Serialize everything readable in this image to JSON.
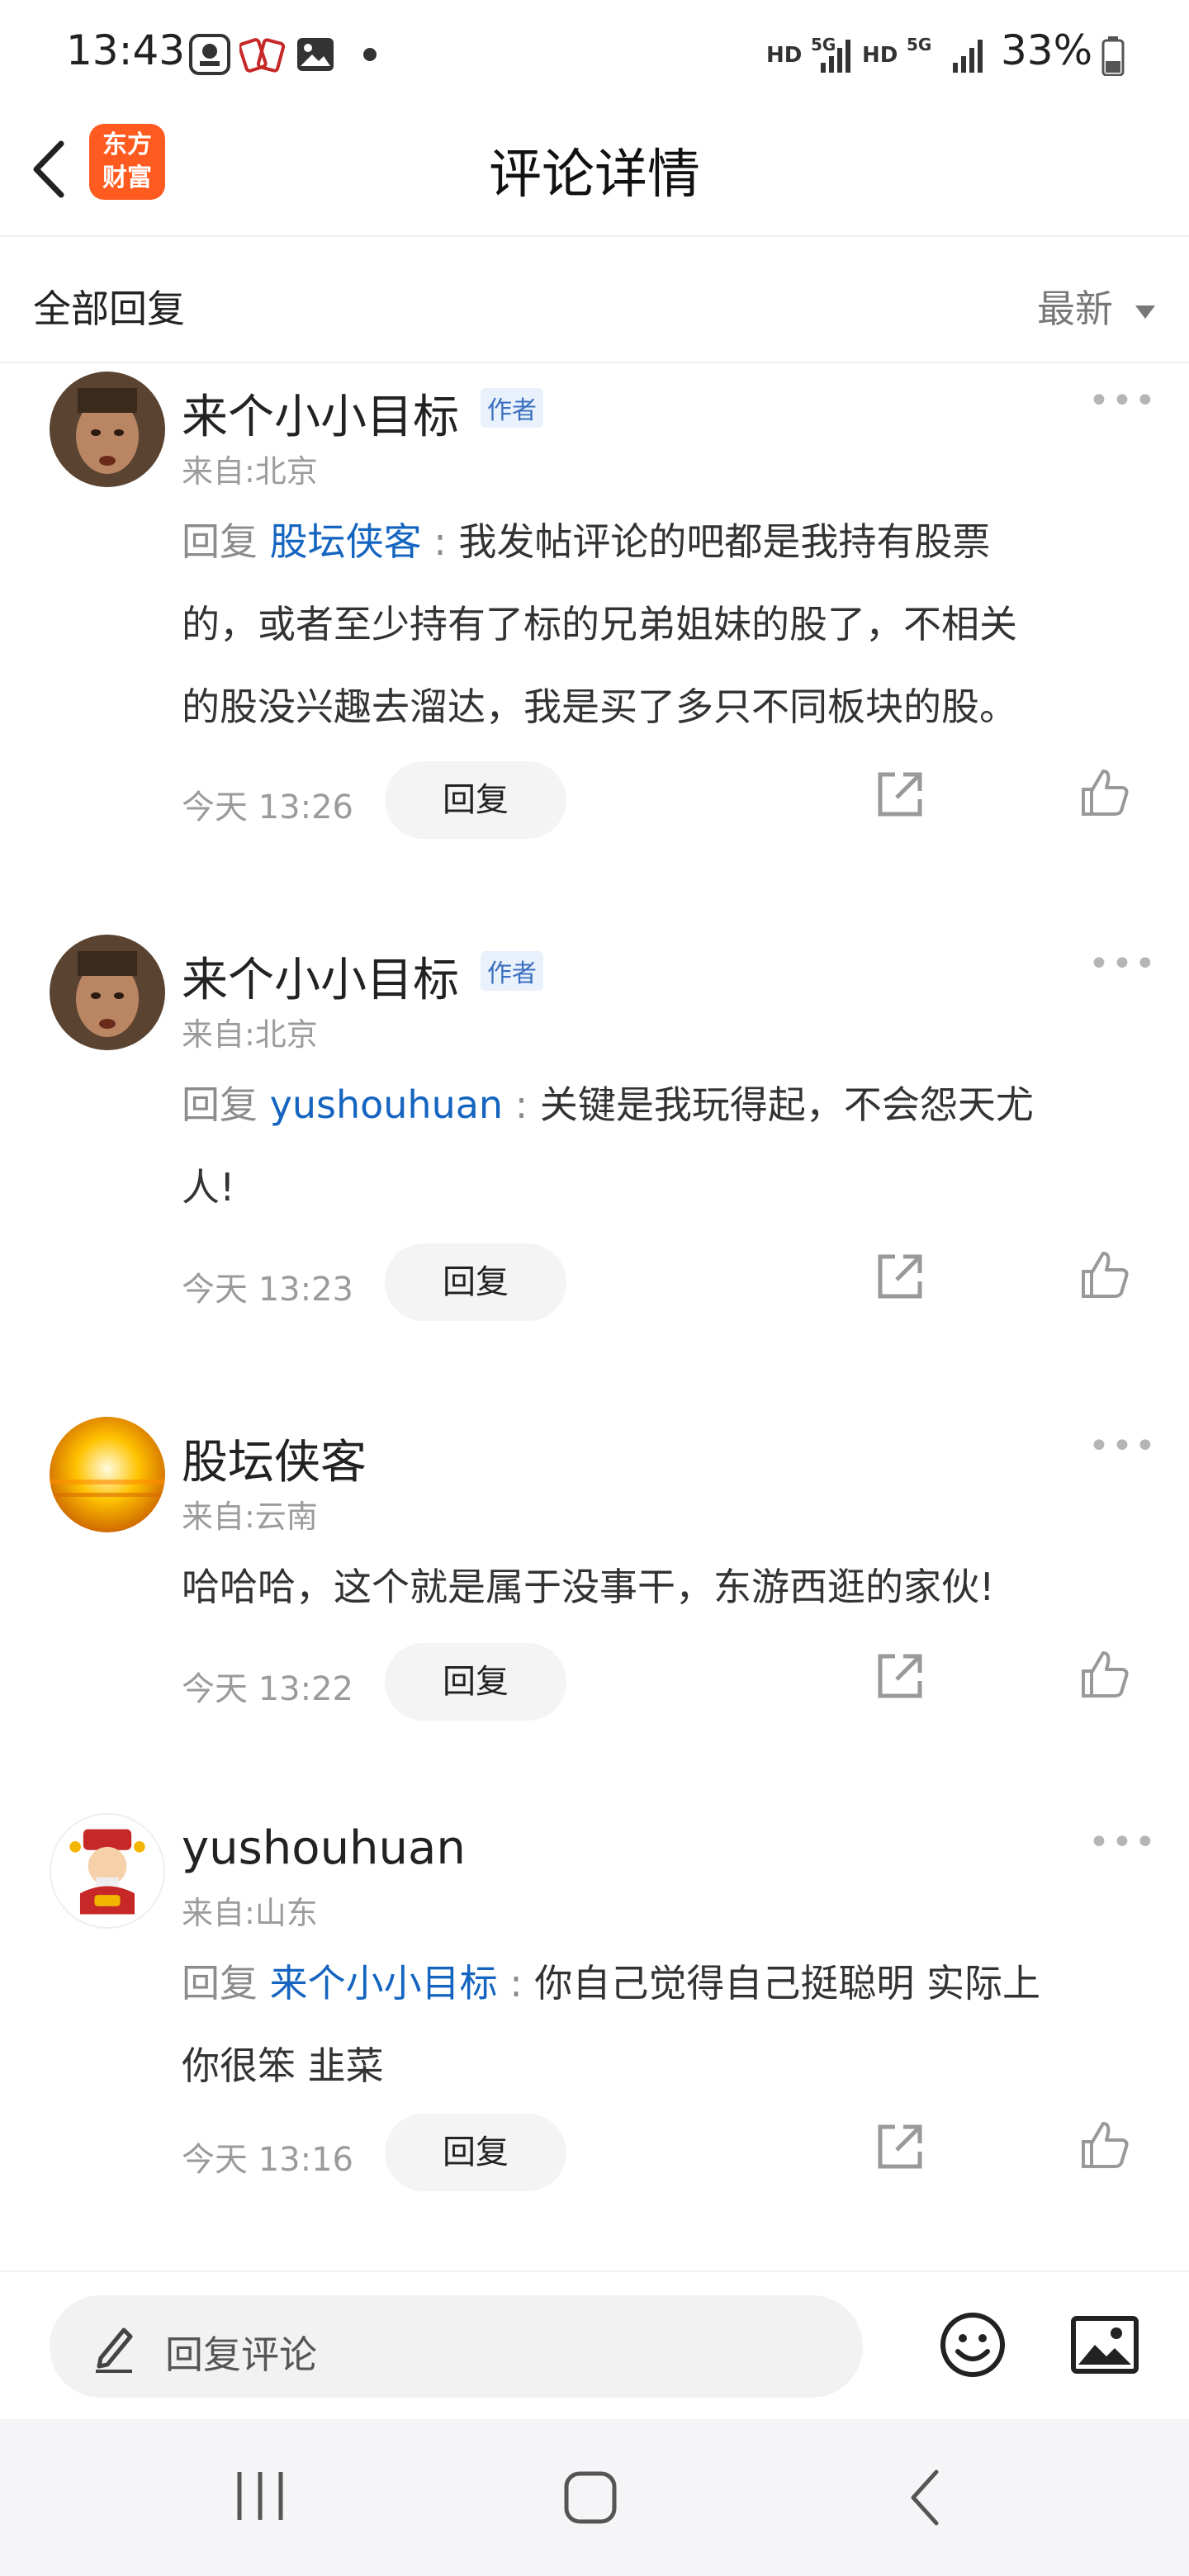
{
  "status_bar": {
    "time": "13:43",
    "battery": "33%",
    "hd1": "HD",
    "hd2": "HD",
    "fiveg1": "5G",
    "fiveg2": "5G"
  },
  "header": {
    "title": "评论详情",
    "logo_line1": "东方",
    "logo_line2": "财富"
  },
  "filter": {
    "label": "全部回复",
    "sort_value": "最新"
  },
  "comments": [
    {
      "name": "来个小小目标",
      "tag": "作者",
      "location": "来自:北京",
      "reply_prefix": "回复",
      "mention": "股坛侠客",
      "separator": " : ",
      "line1": "我发帖评论的吧都是我持有股票",
      "line2": "的，或者至少持有了标的兄弟姐妹的股了，不相关",
      "line3": "的股没兴趣去溜达，我是买了多只不同板块的股。",
      "time": "今天 13:26",
      "reply_label": "回复"
    },
    {
      "name": "来个小小目标",
      "tag": "作者",
      "location": "来自:北京",
      "reply_prefix": "回复",
      "mention": "yushouhuan",
      "separator": " : ",
      "line1": "关键是我玩得起，不会怨天尤",
      "line2": "人!",
      "time": "今天 13:23",
      "reply_label": "回复"
    },
    {
      "name": "股坛侠客",
      "location": "来自:云南",
      "line1": "哈哈哈，这个就是属于没事干，东游西逛的家伙!",
      "time": "今天 13:22",
      "reply_label": "回复"
    },
    {
      "name": "yushouhuan",
      "location": "来自:山东",
      "reply_prefix": "回复",
      "mention": "来个小小目标",
      "separator": " : ",
      "line1": "你自己觉得自己挺聪明 实际上",
      "line2": "你很笨 韭菜",
      "time": "今天 13:16",
      "reply_label": "回复"
    }
  ],
  "input": {
    "placeholder": "回复评论"
  },
  "colors": {
    "accent_link": "#1565c0",
    "logo_bg": "#ff5a1f",
    "muted_text": "#9b9b9b"
  },
  "icons": [
    "back-arrow-icon",
    "pencil-icon",
    "emoji-icon",
    "image-icon",
    "share-icon",
    "thumbs-up-icon",
    "more-dots-icon",
    "sort-triangle-icon",
    "nav-recent-icon",
    "nav-home-icon",
    "nav-back-icon"
  ]
}
